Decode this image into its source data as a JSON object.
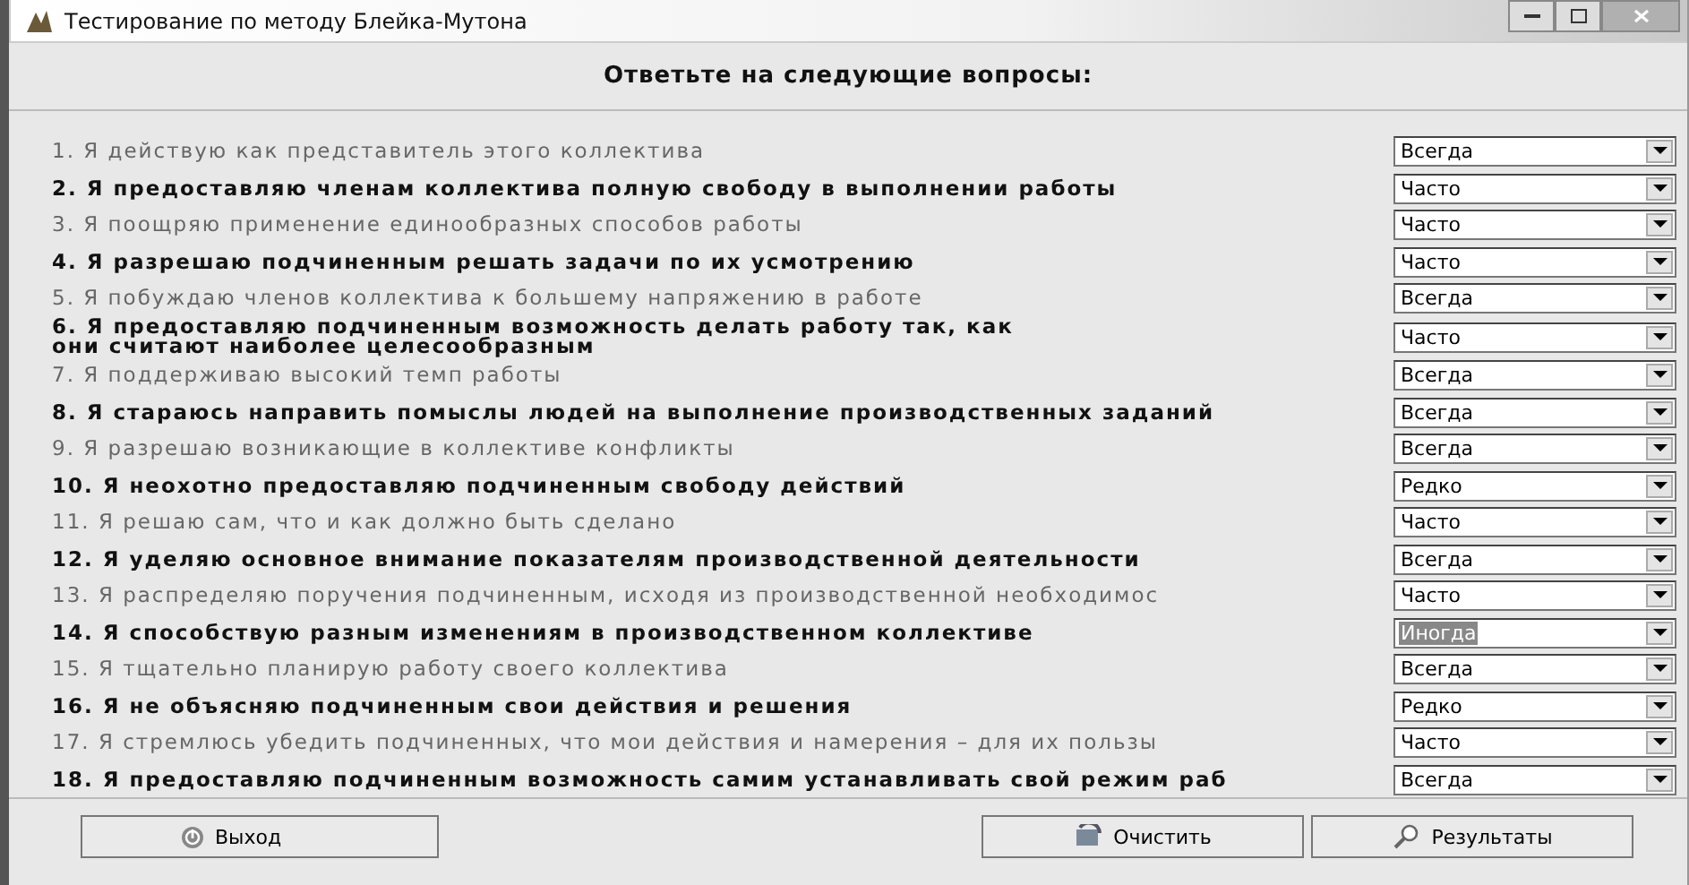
{
  "window": {
    "title": "Тестирование по методу Блейка-Мутона"
  },
  "heading": "Ответьте на следующие вопросы:",
  "questions": [
    {
      "text": "1. Я действую как представитель этого коллектива",
      "kind": "plain",
      "answer": "Всегда",
      "highlighted": false
    },
    {
      "text": "2. Я предоставляю членам коллектива полную свободу в выполнении работы",
      "kind": "bold",
      "answer": "Часто",
      "highlighted": false
    },
    {
      "text": "3. Я поощряю применение единообразных способов работы",
      "kind": "plain",
      "answer": "Часто",
      "highlighted": false
    },
    {
      "text": "4. Я разрешаю подчиненным решать задачи по их усмотрению",
      "kind": "bold",
      "answer": "Часто",
      "highlighted": false
    },
    {
      "text": "5. Я побуждаю членов коллектива к большему напряжению в работе",
      "kind": "plain",
      "answer": "Всегда",
      "highlighted": false
    },
    {
      "text": "6. Я предоставляю подчиненным возможность делать работу так, как\nони считают наиболее целесообразным",
      "kind": "bold",
      "answer": "Часто",
      "highlighted": false
    },
    {
      "text": "7. Я поддерживаю высокий темп работы",
      "kind": "plain",
      "answer": "Всегда",
      "highlighted": false
    },
    {
      "text": "8. Я стараюсь направить помыслы людей на выполнение производственных заданий",
      "kind": "bold",
      "answer": "Всегда",
      "highlighted": false
    },
    {
      "text": "9. Я разрешаю возникающие в коллективе конфликты",
      "kind": "plain",
      "answer": "Всегда",
      "highlighted": false
    },
    {
      "text": "10. Я неохотно предоставляю подчиненным свободу действий",
      "kind": "bold",
      "answer": "Редко",
      "highlighted": false
    },
    {
      "text": "11. Я решаю сам, что и как должно быть сделано",
      "kind": "plain",
      "answer": "Часто",
      "highlighted": false
    },
    {
      "text": "12. Я уделяю основное внимание показателям производственной деятельности",
      "kind": "bold",
      "answer": "Всегда",
      "highlighted": false
    },
    {
      "text": "13. Я распределяю поручения подчиненным, исходя из производственной необходимос",
      "kind": "plain",
      "answer": "Часто",
      "highlighted": false
    },
    {
      "text": "14. Я способствую разным изменениям в производственном коллективе",
      "kind": "bold",
      "answer": "Иногда",
      "highlighted": true
    },
    {
      "text": "15. Я тщательно планирую работу своего коллектива",
      "kind": "plain",
      "answer": "Всегда",
      "highlighted": false
    },
    {
      "text": "16. Я не объясняю подчиненным свои действия и решения",
      "kind": "bold",
      "answer": "Редко",
      "highlighted": false
    },
    {
      "text": "17. Я стремлюсь убедить подчиненных, что мои действия и намерения – для их пользы",
      "kind": "plain",
      "answer": "Часто",
      "highlighted": false
    },
    {
      "text": "18. Я предоставляю подчиненным возможность самим устанавливать свой режим раб",
      "kind": "bold",
      "answer": "Всегда",
      "highlighted": false
    }
  ],
  "buttons": [
    {
      "label": "Выход",
      "kind": "exit"
    },
    {
      "label": "Очистить",
      "kind": "clear"
    },
    {
      "label": "Результаты",
      "kind": "results"
    }
  ]
}
